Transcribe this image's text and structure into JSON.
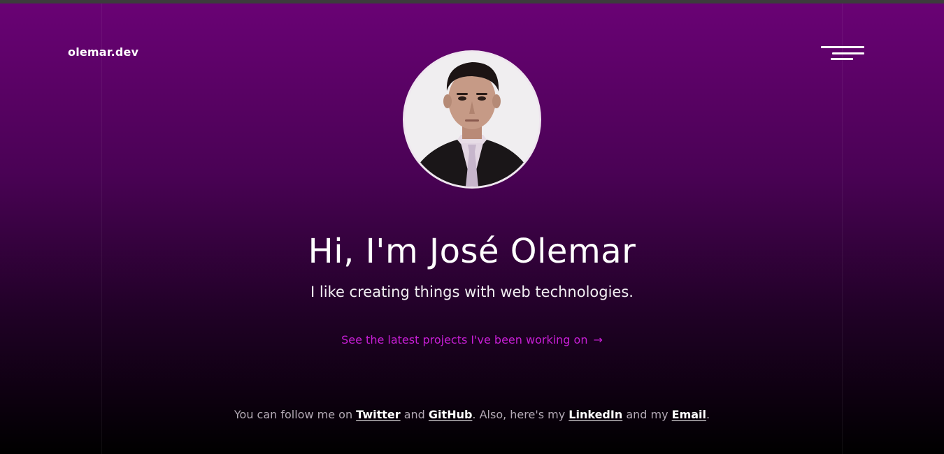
{
  "header": {
    "brand": "olemar.dev",
    "menu_icon": "menu-icon"
  },
  "hero": {
    "avatar_alt": "José Olemar portrait",
    "headline": "Hi, I'm José Olemar",
    "tagline": "I like creating things with web technologies.",
    "projects_link": "See the latest projects I've been working on",
    "projects_arrow": "→"
  },
  "social": {
    "text_1": "You can follow me on ",
    "twitter": "Twitter",
    "text_2": " and ",
    "github": "GitHub",
    "text_3": ". Also, here's my ",
    "linkedin": "LinkedIn",
    "text_4": " and my ",
    "email": "Email",
    "text_5": "."
  },
  "colors": {
    "accent": "#c81fd6",
    "gradient_top": "#6a0275",
    "gradient_bottom": "#000000"
  }
}
